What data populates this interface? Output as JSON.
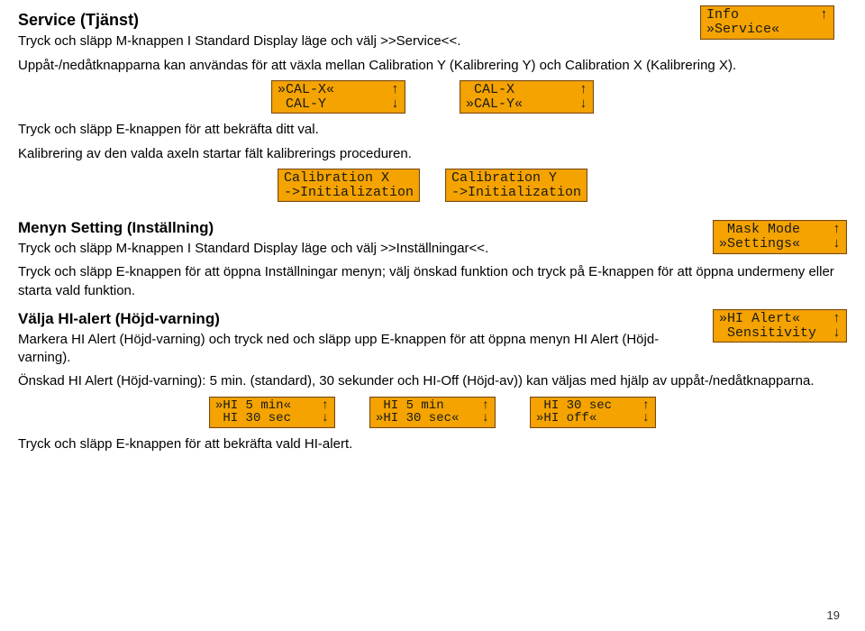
{
  "sec1": {
    "heading": "Service (Tjänst)",
    "p1": "Tryck och släpp M-knappen I Standard Display läge och välj >>Service<<.",
    "p2": "Uppåt-/nedåtknapparna kan användas för att växla mellan Calibration Y (Kalibrering Y) och Calibration X (Kalibrering X).",
    "p3": "Tryck och släpp E-knappen för att bekräfta ditt val.",
    "p4": "Kalibrering av den valda axeln startar fält kalibrerings proceduren.",
    "lcd_info": "Info          ↑\n»Service«",
    "lcd_calx1": "»CAL-X«       ↑\n CAL-Y        ↓",
    "lcd_calx2": " CAL-X        ↑\n»CAL-Y«       ↓",
    "lcd_initX": "Calibration X\n->Initialization",
    "lcd_initY": "Calibration Y\n->Initialization"
  },
  "sec2": {
    "heading": "Menyn Setting (Inställning)",
    "p1": "Tryck och släpp M-knappen I Standard Display läge och välj >>Inställningar<<.",
    "p2": "Tryck och släpp E-knappen för att öppna Inställningar menyn; välj önskad funktion och tryck på E-knappen för att öppna undermeny eller starta vald funktion.",
    "lcd_settings": " Mask Mode    ↑\n»Settings«    ↓"
  },
  "sec3": {
    "heading": "Välja HI-alert (Höjd-varning)",
    "p1": "Markera HI Alert (Höjd-varning) och tryck ned och släpp upp E-knappen för att öppna menyn HI Alert (Höjd-varning).",
    "p2": "Önskad HI Alert (Höjd-varning): 5 min. (standard), 30 sekunder och HI-Off (Höjd-av)) kan väljas med hjälp av uppåt-/nedåtknapparna.",
    "p3": "Tryck och släpp E-knappen för att bekräfta vald HI-alert.",
    "lcd_hi_alert": "»HI Alert«    ↑\n Sensitivity  ↓",
    "lcd_hi1": "»HI 5 min«    ↑\n HI 30 sec    ↓",
    "lcd_hi2": " HI 5 min     ↑\n»HI 30 sec«   ↓",
    "lcd_hi3": " HI 30 sec    ↑\n»HI off«      ↓"
  },
  "page_number": "19"
}
